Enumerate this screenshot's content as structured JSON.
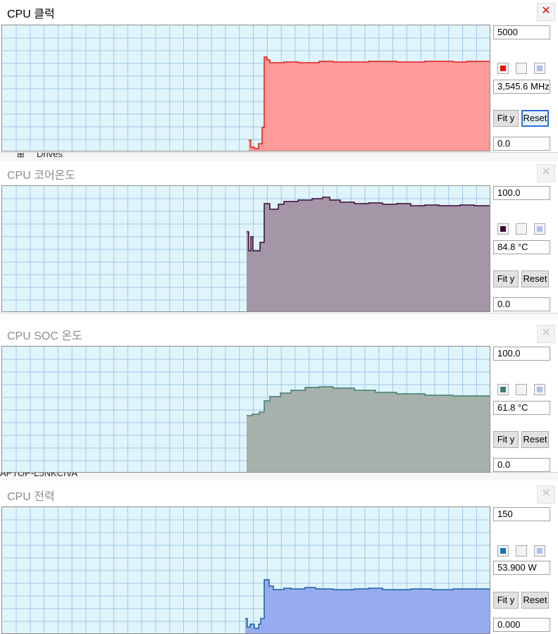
{
  "background_strips": {
    "drives_label": "Drives",
    "computer_name": "APTOP-L5NKCIVA"
  },
  "buttons": {
    "fit_label": "Fit y",
    "reset_label": "Reset"
  },
  "colors": {
    "plot_background": "#e0f5fb",
    "grid": "#9fc6e8",
    "secondary_swatch_1": "#f2f2f2",
    "secondary_swatch_2": "#a9c2f0"
  },
  "panels": [
    {
      "title": "CPU 클럭",
      "state": "active",
      "close_icon": "x",
      "max": "5000",
      "current": "3,545.6 MHz",
      "min": "0.0",
      "color": "#e81010",
      "fill": "#ff9a9a",
      "stroke": "#e21c1c"
    },
    {
      "title": "CPU 코어온도",
      "state": "inactive",
      "close_icon": "x",
      "max": "100.0",
      "current": "84.8 °C",
      "min": "0.0",
      "color": "#3c0b38",
      "fill": "#a495a7",
      "stroke": "#3c0b38"
    },
    {
      "title": "CPU SOC 온도",
      "state": "inactive",
      "close_icon": "x",
      "max": "100.0",
      "current": "61.8 °C",
      "min": "0.0",
      "color": "#3f7d73",
      "fill": "#a7b1ab",
      "stroke": "#3f7d73"
    },
    {
      "title": "CPU 전력",
      "state": "inactive",
      "close_icon": "x",
      "max": "150",
      "current": "53.900 W",
      "min": "0.000",
      "color": "#1271b8",
      "fill": "#97acf0",
      "stroke": "#1a5fa6"
    }
  ]
}
